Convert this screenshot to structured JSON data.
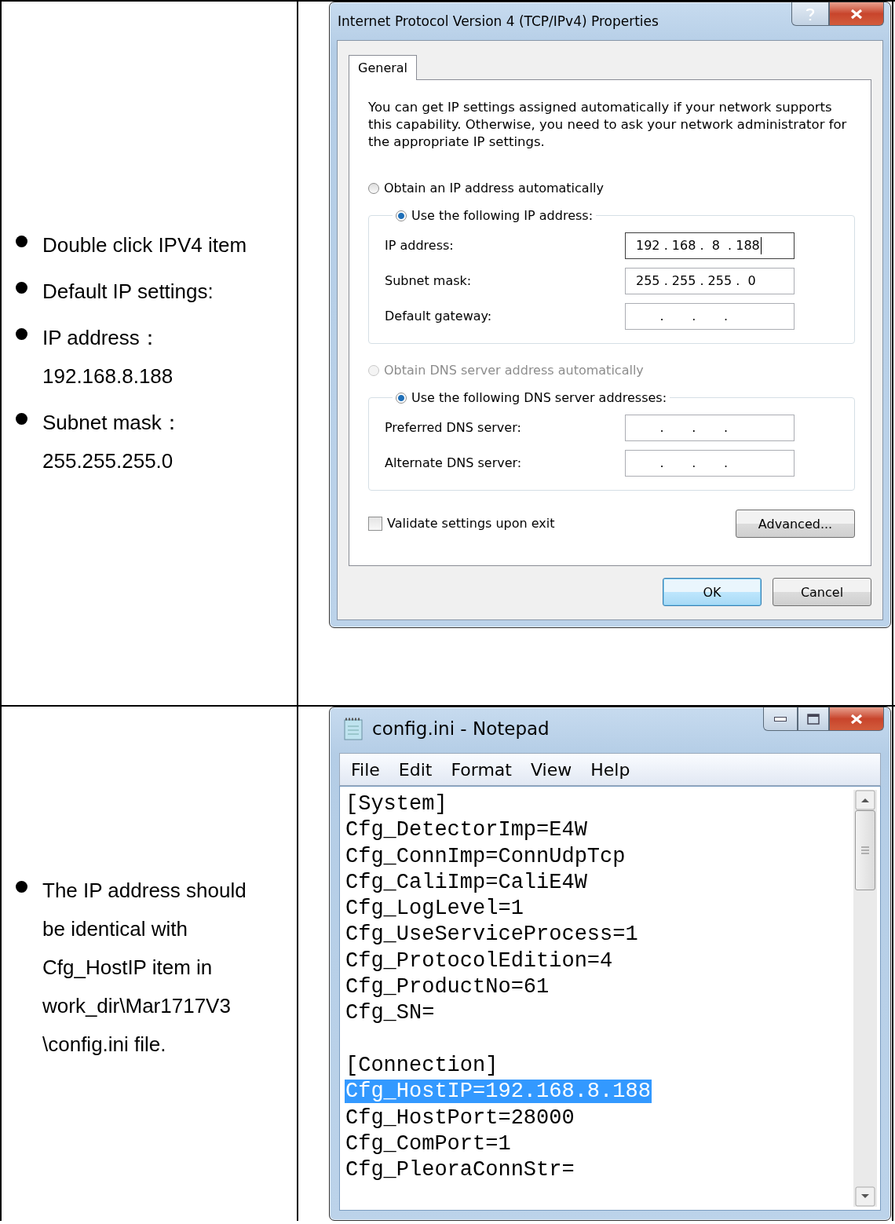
{
  "rows": [
    {
      "bullets": [
        {
          "lines": [
            "Double click IPV4 item"
          ]
        },
        {
          "lines": [
            "Default IP settings:"
          ]
        },
        {
          "lines": [
            "IP address：",
            "192.168.8.188"
          ]
        },
        {
          "lines": [
            "Subnet mask：",
            "255.255.255.0"
          ]
        }
      ],
      "ip_dialog": {
        "title": "Internet Protocol Version 4 (TCP/IPv4) Properties",
        "tabs": [
          {
            "label": "General",
            "selected": true
          }
        ],
        "description": "You can get IP settings assigned automatically if your network supports this capability. Otherwise, you need to ask your network administrator for the appropriate IP settings.",
        "ip_mode": [
          {
            "label": "Obtain an IP address automatically",
            "selected": false,
            "disabled": false
          },
          {
            "label": "Use the following IP address:",
            "selected": true,
            "disabled": false
          }
        ],
        "ip_fields": [
          {
            "label": "IP address:",
            "value": "192 . 168 .  8  . 188",
            "focused": true
          },
          {
            "label": "Subnet mask:",
            "value": "255 . 255 . 255 .  0",
            "focused": false
          },
          {
            "label": "Default gateway:",
            "value": "      .       .       .",
            "focused": false
          }
        ],
        "dns_mode": [
          {
            "label": "Obtain DNS server address automatically",
            "selected": false,
            "disabled": true
          },
          {
            "label": "Use the following DNS server addresses:",
            "selected": true,
            "disabled": false
          }
        ],
        "dns_fields": [
          {
            "label": "Preferred DNS server:",
            "value": "      .       .       .",
            "focused": false
          },
          {
            "label": "Alternate DNS server:",
            "value": "      .       .       .",
            "focused": false
          }
        ],
        "validate": {
          "label": "Validate settings upon exit",
          "checked": false
        },
        "advanced_button": "Advanced...",
        "buttons": [
          {
            "label": "OK",
            "default": true
          },
          {
            "label": "Cancel",
            "default": false
          }
        ]
      }
    },
    {
      "bullets": [
        {
          "lines": [
            "The IP address should",
            "be identical with",
            "Cfg_HostIP item in",
            "work_dir\\Mar1717V3",
            "\\config.ini file."
          ]
        }
      ],
      "notepad": {
        "title": "config.ini - Notepad",
        "menu": [
          "File",
          "Edit",
          "Format",
          "View",
          "Help"
        ],
        "lines": [
          {
            "text": "[System]",
            "kind": "section",
            "highlighted": false
          },
          {
            "text": "Cfg_DetectorImp=E4W",
            "kind": "entry",
            "highlighted": false
          },
          {
            "text": "Cfg_ConnImp=ConnUdpTcp",
            "kind": "entry",
            "highlighted": false
          },
          {
            "text": "Cfg_CaliImp=CaliE4W",
            "kind": "entry",
            "highlighted": false
          },
          {
            "text": "Cfg_LogLevel=1",
            "kind": "entry",
            "highlighted": false
          },
          {
            "text": "Cfg_UseServiceProcess=1",
            "kind": "entry",
            "highlighted": false
          },
          {
            "text": "Cfg_ProtocolEdition=4",
            "kind": "entry",
            "highlighted": false
          },
          {
            "text": "Cfg_ProductNo=61",
            "kind": "entry",
            "highlighted": false
          },
          {
            "text": "Cfg_SN=",
            "kind": "entry",
            "highlighted": false
          },
          {
            "text": "[Connection]",
            "kind": "section",
            "highlighted": false
          },
          {
            "text": "Cfg_HostIP=192.168.8.188",
            "kind": "entry",
            "highlighted": true
          },
          {
            "text": "Cfg_HostPort=28000",
            "kind": "entry",
            "highlighted": false
          },
          {
            "text": "Cfg_ComPort=1",
            "kind": "entry",
            "highlighted": false
          },
          {
            "text": "Cfg_PleoraConnStr=",
            "kind": "entry",
            "highlighted": false
          }
        ]
      }
    }
  ]
}
